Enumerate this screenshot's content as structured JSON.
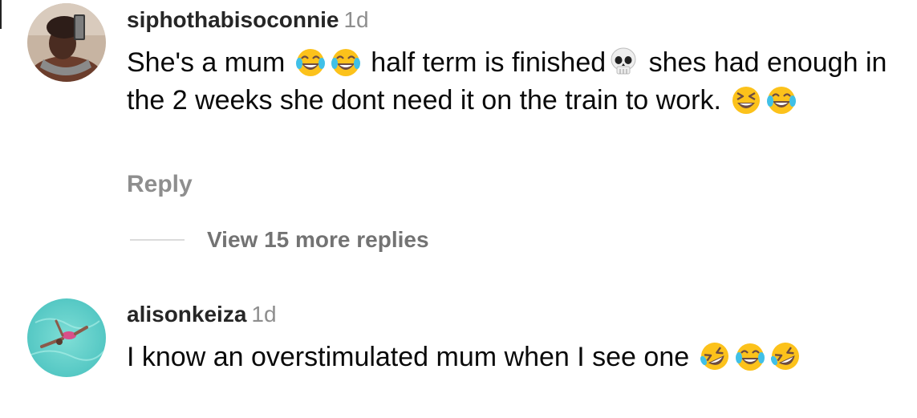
{
  "comments": [
    {
      "username": "siphothabisoconnie",
      "timestamp": "1d",
      "avatar_icon": "profile-photo-selfie",
      "text_segments": [
        "She's a mum ",
        " half term is finished",
        " shes had enough in the 2 weeks she dont need it on the train to work. "
      ],
      "emojis": [
        "face-with-tears-of-joy",
        "face-with-tears-of-joy",
        "skull",
        "grinning-squinting-face",
        "face-with-tears-of-joy"
      ],
      "reply_label": "Reply",
      "view_replies_label": "View 15 more replies"
    },
    {
      "username": "alisonkeiza",
      "timestamp": "1d",
      "avatar_icon": "profile-photo-swimmer",
      "text_segments": [
        "I know an overstimulated mum when I see one "
      ],
      "emojis": [
        "rolling-on-the-floor-laughing",
        "face-with-tears-of-joy",
        "rolling-on-the-floor-laughing"
      ]
    }
  ],
  "colors": {
    "username": "#262626",
    "secondary": "#8e8e8e",
    "emoji_yellow": "#fcc21b",
    "emoji_tear": "#40c0e7"
  }
}
